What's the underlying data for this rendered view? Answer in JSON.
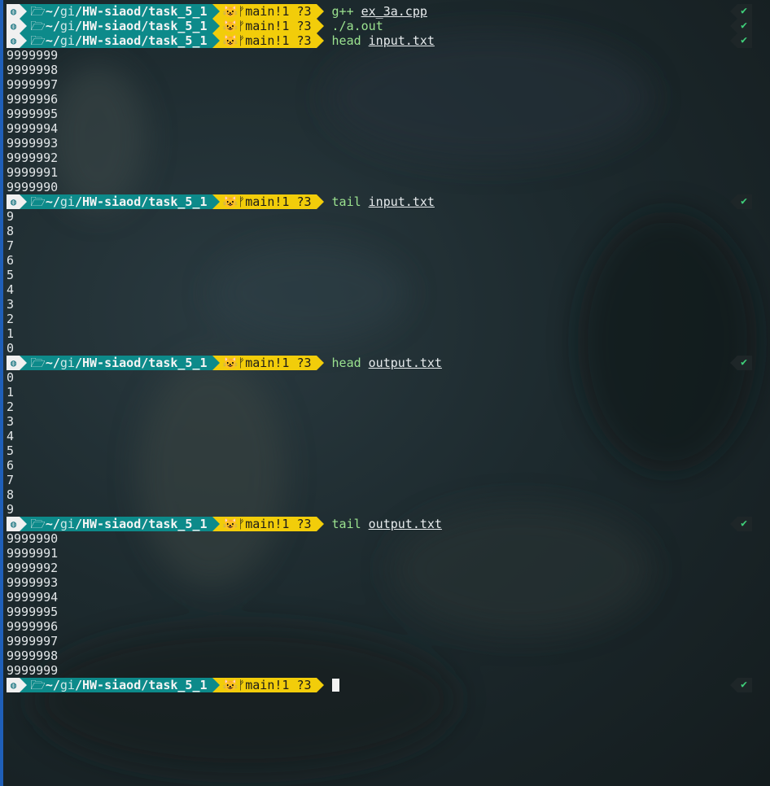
{
  "prompt": {
    "os_icon": "◍",
    "folder_icon": "🗁",
    "dir_home": "~/",
    "dir_mid": "gi",
    "dir_sep": "/",
    "dir_repo": "HW-siaod",
    "dir_tail": "/task_5_1",
    "git_icon": "😺",
    "branch_icon": "ᚠ",
    "branch": "main",
    "git_status": "!1 ?3",
    "ok_mark": "✔"
  },
  "commands": [
    {
      "cmd": "g++",
      "arg": "ex_3a.cpp"
    },
    {
      "cmd": "./a.out",
      "arg": ""
    },
    {
      "cmd": "head",
      "arg": "input.txt"
    },
    {
      "cmd": "tail",
      "arg": "input.txt"
    },
    {
      "cmd": "head",
      "arg": "output.txt"
    },
    {
      "cmd": "tail",
      "arg": "output.txt"
    }
  ],
  "outputs": {
    "head_input": [
      "9999999",
      "9999998",
      "9999997",
      "9999996",
      "9999995",
      "9999994",
      "9999993",
      "9999992",
      "9999991",
      "9999990"
    ],
    "tail_input": [
      "9",
      "8",
      "7",
      "6",
      "5",
      "4",
      "3",
      "2",
      "1",
      "0"
    ],
    "head_output": [
      "0",
      "1",
      "2",
      "3",
      "4",
      "5",
      "6",
      "7",
      "8",
      "9"
    ],
    "tail_output": [
      "9999990",
      "9999991",
      "9999992",
      "9999993",
      "9999994",
      "9999995",
      "9999996",
      "9999997",
      "9999998",
      "9999999"
    ]
  },
  "colors": {
    "segment_teal": "#0d8a8a",
    "segment_yellow": "#f2cd0a",
    "segment_white": "#f0f0f0",
    "command_green": "#9be28f",
    "ok_green": "#3fd07a"
  }
}
